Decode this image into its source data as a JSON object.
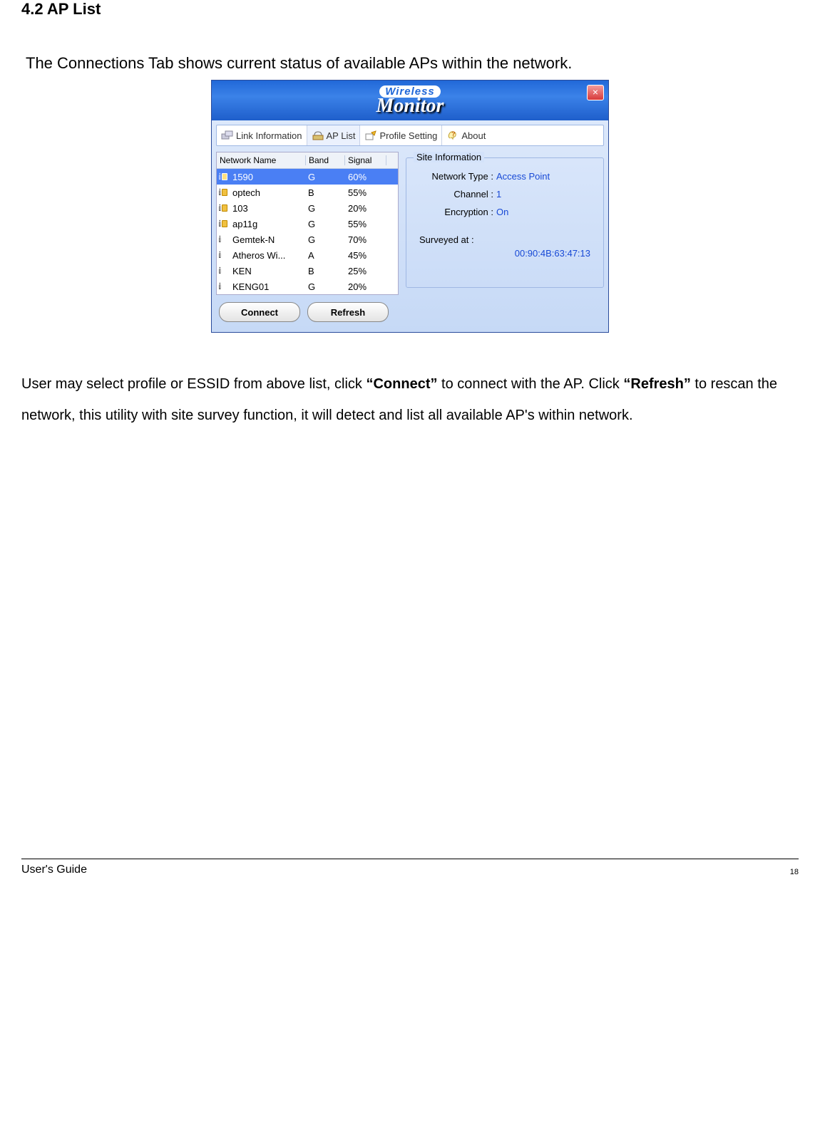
{
  "doc": {
    "section_title": "4.2 AP List",
    "intro": "The Connections Tab shows current status of available APs within the network.",
    "para1_pre": "User may select profile or ESSID from above list, click ",
    "para1_bold1": "“Connect”",
    "para1_mid": " to connect with the AP. Click ",
    "para1_bold2": "“Refresh”",
    "para1_post": " to rescan the network, this utility with site survey function, it will detect and list all available AP's within network.",
    "footer_left": "User's Guide",
    "footer_right": "18"
  },
  "window": {
    "logo_top": "Wireless",
    "logo_bottom": "Monitor",
    "close": "×",
    "tabs": {
      "link_info": "Link Information",
      "ap_list": "AP List",
      "profile": "Profile Setting",
      "about": "About"
    },
    "columns": {
      "name": "Network Name",
      "band": "Band",
      "signal": "Signal"
    },
    "rows": [
      {
        "name": "1590",
        "band": "G",
        "signal": "60%",
        "locked": true,
        "selected": true
      },
      {
        "name": "optech",
        "band": "B",
        "signal": "55%",
        "locked": true,
        "selected": false
      },
      {
        "name": "103",
        "band": "G",
        "signal": "20%",
        "locked": true,
        "selected": false
      },
      {
        "name": "ap11g",
        "band": "G",
        "signal": "55%",
        "locked": true,
        "selected": false
      },
      {
        "name": "Gemtek-N",
        "band": "G",
        "signal": "70%",
        "locked": false,
        "selected": false
      },
      {
        "name": "Atheros Wi...",
        "band": "A",
        "signal": "45%",
        "locked": false,
        "selected": false
      },
      {
        "name": "KEN",
        "band": "B",
        "signal": "25%",
        "locked": false,
        "selected": false
      },
      {
        "name": "KENG01",
        "band": "G",
        "signal": "20%",
        "locked": false,
        "selected": false
      }
    ],
    "buttons": {
      "connect": "Connect",
      "refresh": "Refresh"
    },
    "siteinfo": {
      "legend": "Site Information",
      "net_type_label": "Network Type :",
      "net_type_value": "Access Point",
      "channel_label": "Channel :",
      "channel_value": "1",
      "encryption_label": "Encryption :",
      "encryption_value": "On",
      "surveyed_label": "Surveyed at :",
      "mac": "00:90:4B:63:47:13"
    }
  }
}
